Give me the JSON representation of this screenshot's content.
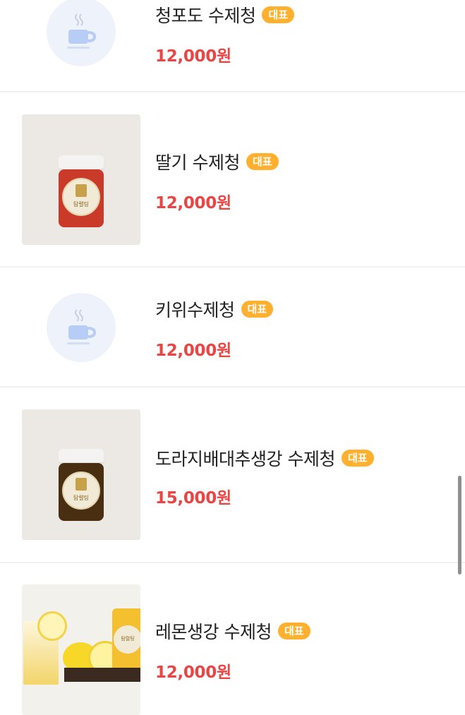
{
  "products": [
    {
      "name": "청포도 수제청",
      "badge": "대표",
      "price": "12,000원",
      "thumb": "tea-cup-icon"
    },
    {
      "name": "딸기 수제청",
      "badge": "대표",
      "price": "12,000원",
      "thumb": "jar-photo",
      "jar_label": "탐렬팅",
      "jar_color": "#c93a28"
    },
    {
      "name": "키위수제청",
      "badge": "대표",
      "price": "12,000원",
      "thumb": "tea-cup-icon"
    },
    {
      "name": "도라지배대추생강 수제청",
      "badge": "대표",
      "price": "15,000원",
      "thumb": "jar-photo",
      "jar_label": "탐렬팅",
      "jar_color": "#4a2e12"
    },
    {
      "name": "레몬생강 수제청",
      "badge": "대표",
      "price": "12,000원",
      "thumb": "lemon-photo",
      "jar_label": "탐렬팅"
    }
  ],
  "colors": {
    "price": "#e84545",
    "badge": "#ffb02e",
    "icon_bg": "#eef3fb"
  }
}
